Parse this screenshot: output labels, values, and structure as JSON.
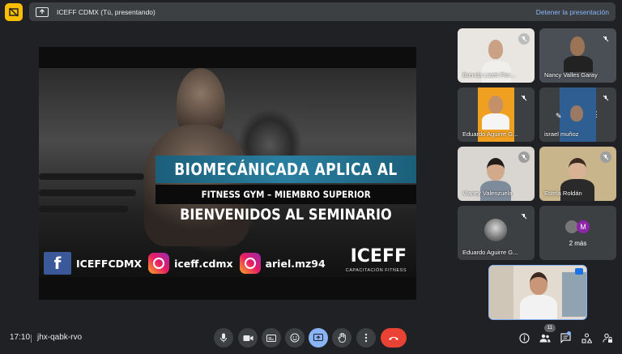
{
  "header": {
    "presenting_title": "ICEFF CDMX (Tú, presentando)",
    "stop_presenting_label": "Detener la presentación"
  },
  "slide": {
    "title_line1": "BIOMECÁNICADA APLICA AL",
    "title_line2": "FITNESS GYM – MIEMBRO SUPERIOR",
    "title_line3": "BIENVENIDOS AL SEMINARIO",
    "social": {
      "facebook_icon": "f",
      "facebook_handle": "ICEFFCDMX",
      "instagram_handle_1": "iceff.cdmx",
      "instagram_handle_2": "ariel.mz94"
    },
    "logo_text": "ICEFF",
    "logo_sub": "CAPACITACIÓN FITNESS"
  },
  "participants": [
    {
      "name": "Brenda Lizett Flor...",
      "muted": true
    },
    {
      "name": "Nancy Valles Garay",
      "muted": true
    },
    {
      "name": "Eduardo Aguirre G...",
      "muted": true
    },
    {
      "name": "israel muñoz",
      "muted": true
    },
    {
      "name": "Vianey Valenzuela",
      "muted": true
    },
    {
      "name": "Estela Roldán",
      "muted": true
    },
    {
      "name": "Eduardo Aguirre G...",
      "muted": true
    },
    {
      "name": "2 más",
      "avatar_letter": "M"
    }
  ],
  "footer": {
    "time": "17:10",
    "meeting_code": "jhx-qabk-rvo",
    "people_count": "11"
  },
  "colors": {
    "background": "#202124",
    "tile": "#3c4043",
    "accent_blue": "#8ab4f8",
    "end_call_red": "#ea4335",
    "badge_yellow": "#fbbc04"
  }
}
